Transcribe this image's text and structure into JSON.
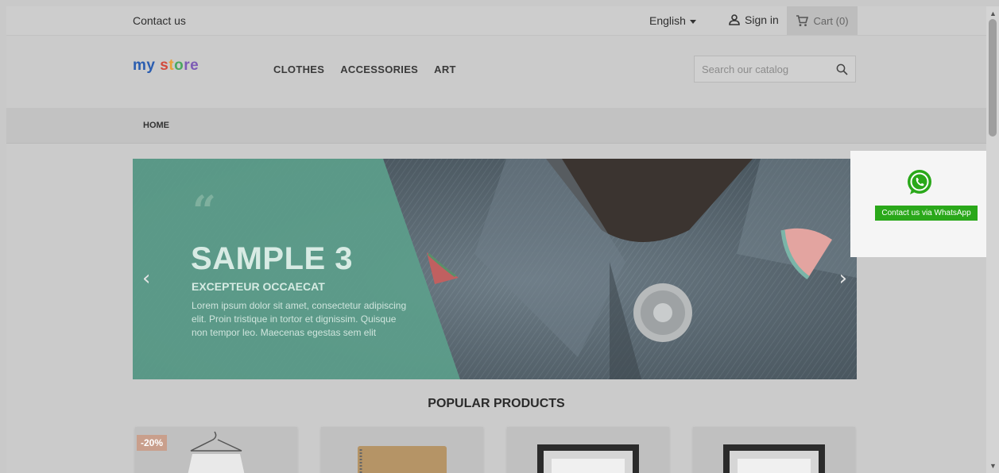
{
  "topbar": {
    "contact": "Contact us",
    "language": "English",
    "signin": "Sign in",
    "cart": "Cart (0)"
  },
  "header": {
    "logo_parts": [
      "my",
      " s",
      "t",
      "o",
      "re"
    ],
    "nav": [
      "CLOTHES",
      "ACCESSORIES",
      "ART"
    ],
    "search_placeholder": "Search our catalog"
  },
  "breadcrumb": [
    "HOME"
  ],
  "slider": {
    "quote_mark": "“",
    "title": "SAMPLE 3",
    "subtitle": "EXCEPTEUR OCCAECAT",
    "text": "Lorem ipsum dolor sit amet, consectetur adipiscing elit. Proin tristique in tortor et dignissim. Quisque non tempor leo. Maecenas egestas sem elit",
    "prev": "‹",
    "next": "›"
  },
  "whatsapp": {
    "button": "Contact us via WhatsApp"
  },
  "products": {
    "heading": "POPULAR PRODUCTS",
    "badge": "-20%"
  },
  "colors": {
    "slider_panel": "#5c9e8b",
    "whatsapp_green": "#2aa81a",
    "badge": "#c99f8c"
  }
}
